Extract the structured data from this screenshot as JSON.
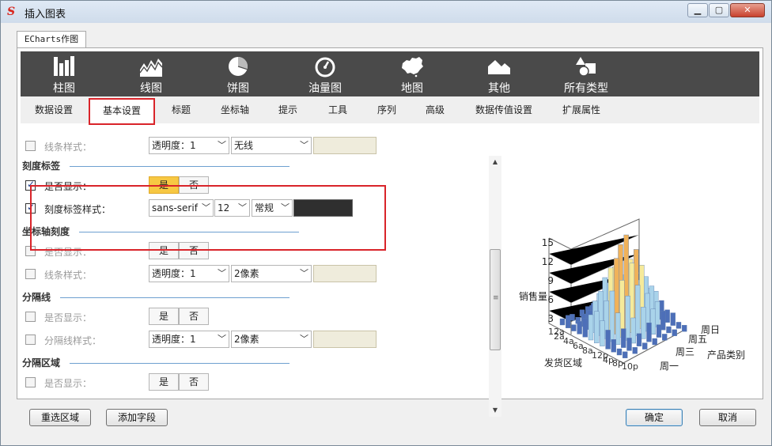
{
  "window": {
    "title": "插入图表",
    "app_icon_glyph": "S"
  },
  "outer_tab": {
    "label": "ECharts作图"
  },
  "chart_types": [
    {
      "label": "柱图",
      "icon": "bar-chart-icon"
    },
    {
      "label": "线图",
      "icon": "line-chart-icon"
    },
    {
      "label": "饼图",
      "icon": "pie-chart-icon"
    },
    {
      "label": "油量图",
      "icon": "gauge-icon"
    },
    {
      "label": "地图",
      "icon": "map-icon"
    },
    {
      "label": "其他",
      "icon": "other-chart-icon"
    },
    {
      "label": "所有类型",
      "icon": "all-types-icon"
    }
  ],
  "sub_tabs": [
    {
      "label": "数据设置",
      "active": false
    },
    {
      "label": "基本设置",
      "active": true
    },
    {
      "label": "标题",
      "active": false
    },
    {
      "label": "坐标轴",
      "active": false
    },
    {
      "label": "提示",
      "active": false
    },
    {
      "label": "工具",
      "active": false
    },
    {
      "label": "序列",
      "active": false
    },
    {
      "label": "高级",
      "active": false
    },
    {
      "label": "数据传值设置",
      "active": false
    },
    {
      "label": "扩展属性",
      "active": false
    }
  ],
  "settings": {
    "line_style_row": {
      "label": "线条样式：",
      "opacity_select": "透明度：1",
      "line_select": "无线",
      "checked": false
    },
    "tick_label": {
      "title": "刻度标签",
      "show_row": {
        "label": "是否显示：",
        "yes": "是",
        "no": "否",
        "checked": true,
        "selected": "是"
      },
      "style_row": {
        "label": "刻度标签样式：",
        "font": "sans-serif",
        "size": "12",
        "weight": "常规",
        "checked": true,
        "color": "#2f2f2f"
      }
    },
    "axis_tick": {
      "title": "坐标轴刻度",
      "show_row": {
        "label": "是否显示：",
        "yes": "是",
        "no": "否",
        "checked": false
      },
      "line_row": {
        "label": "线条样式：",
        "opacity_select": "透明度：1",
        "width_select": "2像素",
        "checked": false
      }
    },
    "split_line": {
      "title": "分隔线",
      "show_row": {
        "label": "是否显示：",
        "yes": "是",
        "no": "否",
        "checked": false
      },
      "style_row": {
        "label": "分隔线样式：",
        "opacity_select": "透明度：1",
        "width_select": "2像素",
        "checked": false
      }
    },
    "split_area": {
      "title": "分隔区域",
      "show_row": {
        "label": "是否显示：",
        "yes": "是",
        "no": "否",
        "checked": false
      }
    }
  },
  "preview": {
    "y_axis_name": "销售量",
    "y_ticks": [
      "15",
      "12",
      "9",
      "6",
      "3"
    ],
    "x_axis_name": "发货区域",
    "z_axis_name": "产品类别",
    "z_ticks": [
      "周日",
      "周五",
      "周三",
      "周一"
    ],
    "x_tick_fragment": "10p",
    "x_tick_overlap": "12a",
    "colors": {
      "low": "#4d6fb8",
      "mid": "#a9d3ea",
      "high": "#f6ea9a",
      "peak": "#f0b25a"
    }
  },
  "footer": {
    "reselect": "重选区域",
    "add_field": "添加字段",
    "ok": "确定",
    "cancel": "取消"
  }
}
